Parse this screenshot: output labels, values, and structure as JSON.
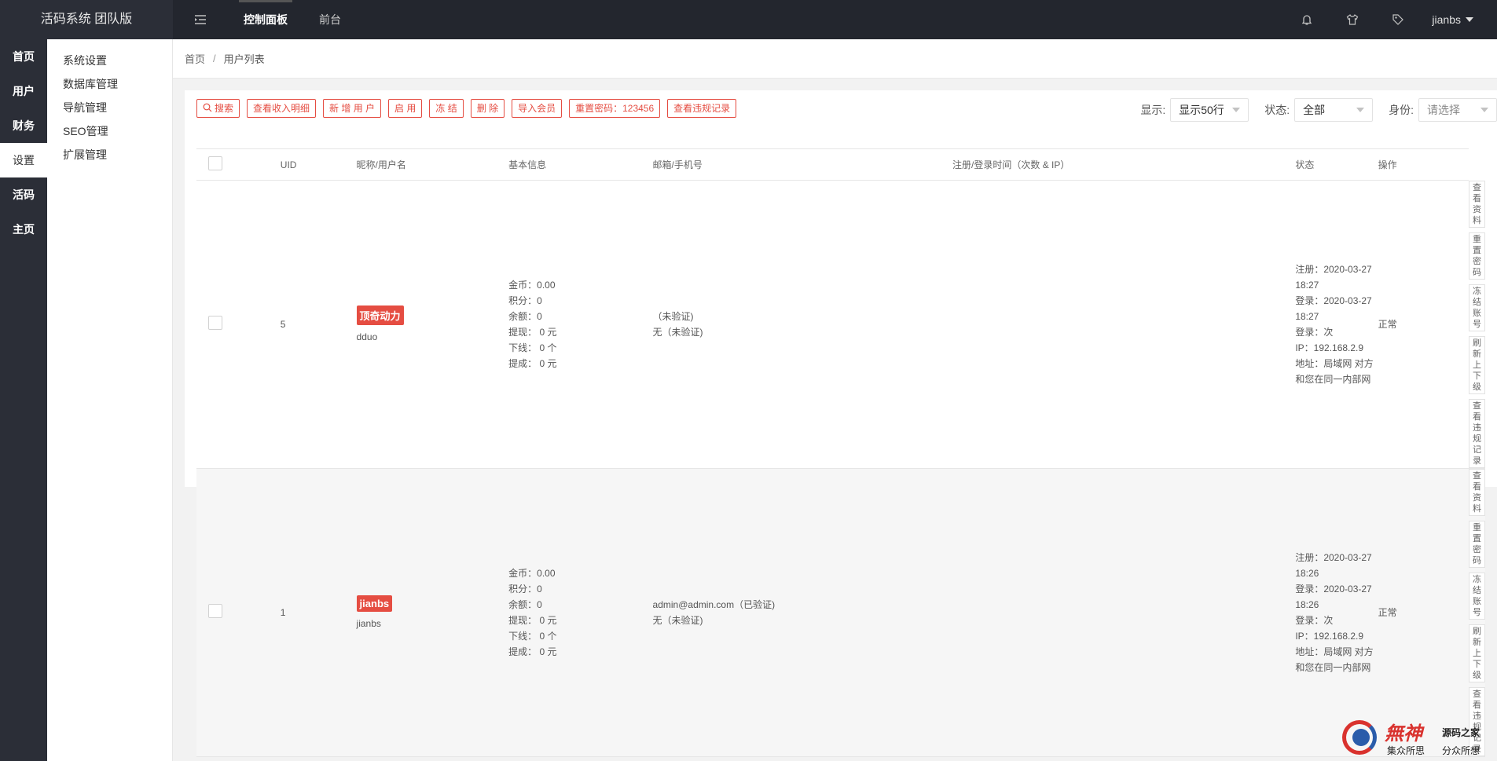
{
  "app": {
    "title": "活码系统 团队版"
  },
  "top_nav": {
    "items": [
      "控制面板",
      "前台"
    ],
    "active": 0
  },
  "user": {
    "name": "jianbs"
  },
  "icons": {
    "toggle": "menu-toggle-icon",
    "bell": "bell-icon",
    "shirt": "shirt-icon",
    "tag": "tag-icon"
  },
  "side_main": {
    "items": [
      "首页",
      "用户",
      "财务",
      "设置",
      "活码",
      "主页"
    ],
    "active": 3
  },
  "side_sub": {
    "items": [
      "系统设置",
      "数据库管理",
      "导航管理",
      "SEO管理",
      "扩展管理"
    ]
  },
  "breadcrumb": {
    "home": "首页",
    "sep": "/",
    "current": "用户列表"
  },
  "toolbar": {
    "search": "搜索",
    "income": "查看收入明细",
    "add_user": "新 增 用 户",
    "enable": "启 用",
    "freeze": "冻 结",
    "delete": "删 除",
    "import": "导入会员",
    "reset_pwd": "重置密码：123456",
    "violations": "查看违规记录"
  },
  "filters": {
    "display_label": "显示:",
    "display_value": "显示50行",
    "status_label": "状态:",
    "status_value": "全部",
    "role_label": "身份:",
    "role_placeholder": "请选择"
  },
  "table": {
    "headers": [
      "UID",
      "昵称/用户名",
      "基本信息",
      "邮箱/手机号",
      "注册/登录时间（次数 & IP）",
      "状态",
      "操作"
    ],
    "rows": [
      {
        "uid": "5",
        "nickname": "顶奇动力",
        "username": "dduo",
        "info": [
          "金币：0.00",
          "积分：0",
          "余额：0",
          "提现： 0 元",
          "下线： 0 个",
          "提成： 0 元"
        ],
        "contact": [
          "（未验证)",
          "无（未验证)"
        ],
        "times": [
          "注册：2020-03-27 18:27",
          "登录：2020-03-27 18:27",
          "登录：次",
          "IP：192.168.2.9",
          "地址：局域网 对方和您在同一内部网"
        ],
        "status": "正常",
        "ops": [
          "查看资料",
          "重置密码",
          "冻结账号",
          "刷新上下级",
          "查看违规记录"
        ]
      },
      {
        "uid": "1",
        "nickname": "jianbs",
        "username": "jianbs",
        "info": [
          "金币：0.00",
          "积分：0",
          "余额：0",
          "提现： 0 元",
          "下线： 0 个",
          "提成： 0 元"
        ],
        "contact": [
          "admin@admin.com（已验证)",
          "无（未验证)"
        ],
        "times": [
          "注册：2020-03-27 18:26",
          "登录：2020-03-27 18:26",
          "登录：次",
          "IP：192.168.2.9",
          "地址：局域网 对方和您在同一内部网"
        ],
        "status": "正常",
        "ops": [
          "查看资料",
          "重置密码",
          "冻结账号",
          "刷新上下级",
          "查看违规记录"
        ]
      }
    ]
  },
  "watermark": {
    "logo_text": "無神",
    "name": "源码之家",
    "slogan_left": "集众所思",
    "slogan_right": "分众所想"
  }
}
